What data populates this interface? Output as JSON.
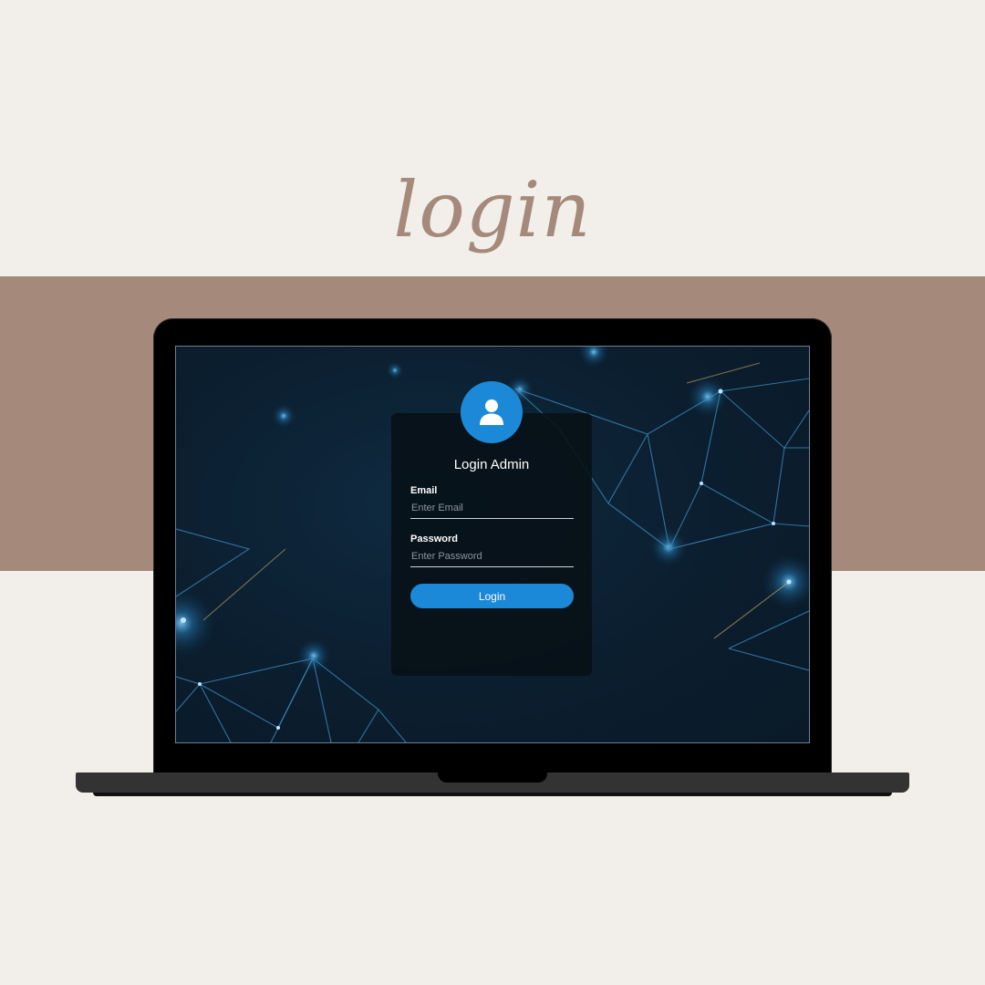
{
  "heading": "login",
  "login_form": {
    "title": "Login Admin",
    "email": {
      "label": "Email",
      "placeholder": "Enter Email",
      "value": ""
    },
    "password": {
      "label": "Password",
      "placeholder": "Enter Password",
      "value": ""
    },
    "submit_label": "Login"
  },
  "icons": {
    "avatar": "user-icon"
  },
  "colors": {
    "page_background": "#f2efea",
    "band": "#a58a7b",
    "heading": "#a58a7b",
    "accent": "#1c88d8",
    "card": "#071016",
    "screen_background": "#0b1e2f",
    "network_lines": "#3f8fc2"
  }
}
